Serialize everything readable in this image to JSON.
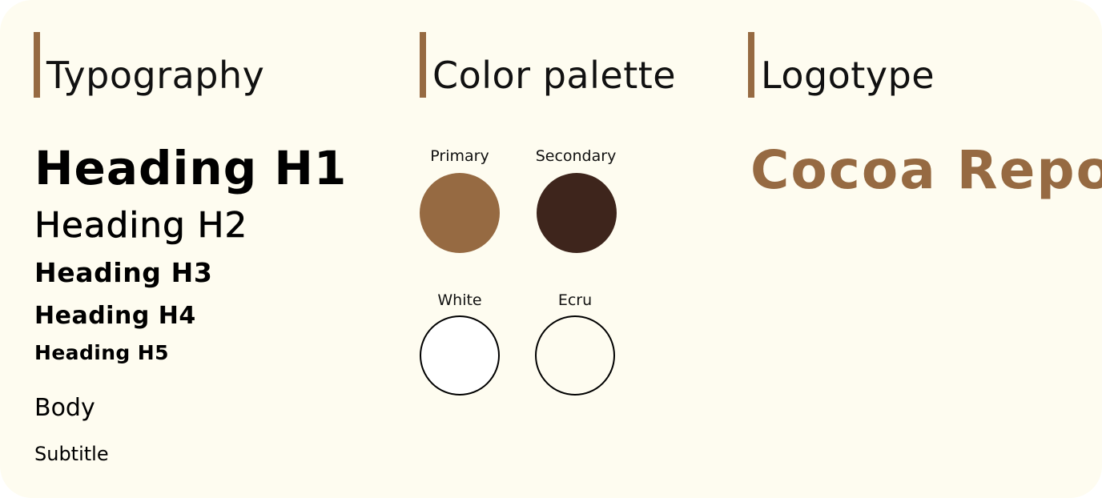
{
  "sections": {
    "typography": {
      "title": "Typography"
    },
    "palette": {
      "title": "Color palette"
    },
    "logotype": {
      "title": "Logotype"
    }
  },
  "typography": {
    "h1": "Heading H1",
    "h2": "Heading H2",
    "h3": "Heading H3",
    "h4": "Heading H4",
    "h5": "Heading H5",
    "body": "Body",
    "subtitle": "Subtitle"
  },
  "palette": {
    "colors": [
      {
        "label": "Primary",
        "hex": "#966a42",
        "outlined": false
      },
      {
        "label": "Secondary",
        "hex": "#3e251c",
        "outlined": false
      },
      {
        "label": "White",
        "hex": "#ffffff",
        "outlined": true
      },
      {
        "label": "Ecru",
        "hex": "#fefcf0",
        "outlined": true
      }
    ]
  },
  "logotype": {
    "text": "Cocoa Repo"
  },
  "theme": {
    "background": "#fefcf0",
    "accent": "#966a42",
    "text": "#000000"
  }
}
